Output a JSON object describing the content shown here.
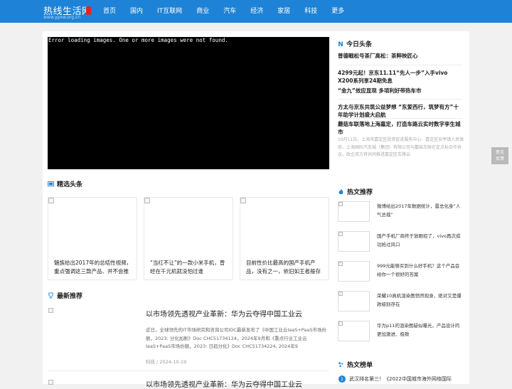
{
  "header": {
    "logo_text": "热线生活网",
    "logo_sub": "www.ypxw.org.cn",
    "nav": [
      "首页",
      "国内",
      "IT互联网",
      "商业",
      "汽车",
      "经济",
      "家居",
      "科技",
      "更多"
    ]
  },
  "banner": {
    "error_text": "Error loading images. One or more images were not found."
  },
  "today": {
    "heading": "今日头条",
    "items": [
      "普德戰松号茶厂高松：茶粹映匠心",
      "4299元起！京东11.11“先人一步”入手vivo X200系列享24期免息",
      "“金九”效应显现  多项利好带热车市",
      "方太与京东共筑公益梦想 “东爱西行，筑梦有方”十年助学计划盛大启航",
      "蘑菇车联落地上海嘉定，打造车路云实时数字孪生城市"
    ],
    "desc": "10月11日，上海市嘉定区投资促进服务中心、嘉定区安亭镇人民政府、上海国际汽车城（集团）有限公司与蘑菇车联在定点标合作协议，政企双方将共同推进嘉定区车路云"
  },
  "featured": {
    "heading": "精选头条",
    "cards": [
      "魅族给出2017年的总结性视频，重点强调这三款产品、并不会推出新品",
      "“当红不让”的一款小米手机，曾经在千元机就没怕过谁",
      "目前性价比最高的国产手机产品，没有之一，依旧如王者般存在"
    ]
  },
  "latest": {
    "heading": "最新推荐",
    "article": {
      "title": "以市场领先透视产业革新：华为云夺得中国工业云",
      "body": "近日，全球领先的IT市场研究和咨询公司IDC最新发布了《中国工业云IaaS+PaaS市场份额，2023: 分化加剧》Doc CHC51734124，2024年9月和《重点行业工业云IaaS+PaaS市场份额，2023: 日趋分化》Doc CHC51734224, 2024年9",
      "meta": "科技 / 2024-10-19"
    },
    "article2_title": "以市场领先透视产业革新：华为云夺得中国工业云"
  },
  "hot_recommend": {
    "heading": "热文推荐",
    "items": [
      "微博给出2017年数据统计，雷总化身“人气总裁”",
      "国产手机厂商终于放眼招了，vivo再次成功抢过风口",
      "999元能够买到什么好手机？这个产品会给你一个很好的答案",
      "荣耀10真机渲染图悄然现身，绝对又是爆款级别存在",
      "华为p11的渲染图疑似曝光，产品设计的更加激进、极致"
    ]
  },
  "hot_rank": {
    "heading": "热文榜单",
    "first_num": "1",
    "first_text": "武汉排名第三！《2022中国城市海外网络国际"
  },
  "float_button": {
    "line1": "意见",
    "line2": "反馈"
  },
  "colors": {
    "brand": "#1e83d6",
    "accent": "#e02424"
  }
}
